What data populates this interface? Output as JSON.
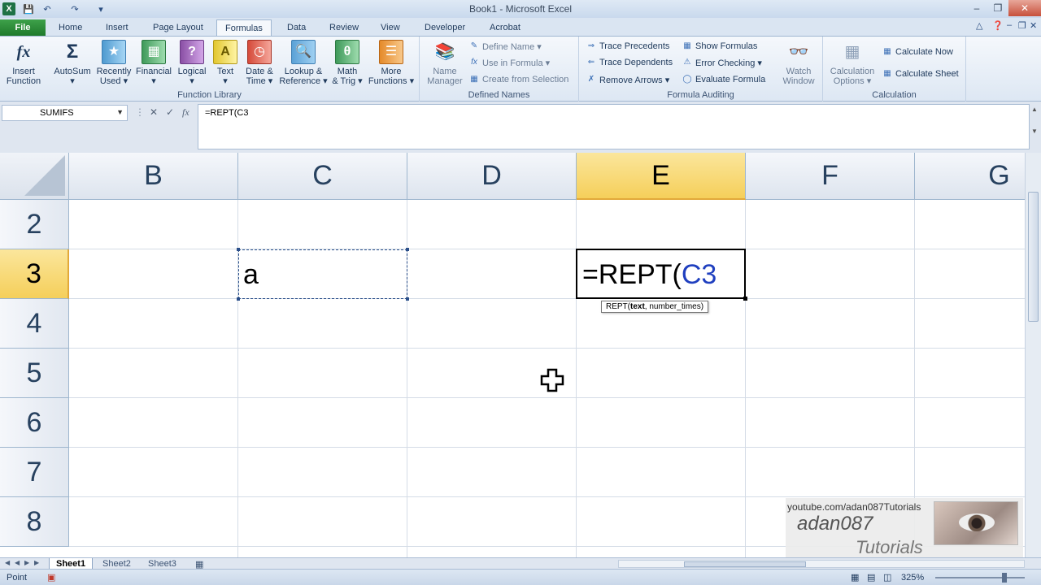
{
  "window": {
    "title": "Book1 - Microsoft Excel"
  },
  "tabs": [
    "File",
    "Home",
    "Insert",
    "Page Layout",
    "Formulas",
    "Data",
    "Review",
    "View",
    "Developer",
    "Acrobat"
  ],
  "ribbon": {
    "function_library": {
      "label": "Function Library",
      "insert_function": "Insert\nFunction",
      "buttons": [
        {
          "l1": "AutoSum",
          "l2": "▾"
        },
        {
          "l1": "Recently",
          "l2": "Used ▾"
        },
        {
          "l1": "Financial",
          "l2": "▾"
        },
        {
          "l1": "Logical",
          "l2": "▾"
        },
        {
          "l1": "Text",
          "l2": "▾"
        },
        {
          "l1": "Date &",
          "l2": "Time ▾"
        },
        {
          "l1": "Lookup &",
          "l2": "Reference ▾"
        },
        {
          "l1": "Math",
          "l2": "& Trig ▾"
        },
        {
          "l1": "More",
          "l2": "Functions ▾"
        }
      ]
    },
    "defined_names": {
      "label": "Defined Names",
      "name_manager_l1": "Name",
      "name_manager_l2": "Manager",
      "define_name": "Define Name ▾",
      "use_in_formula": "Use in Formula ▾",
      "create_from_selection": "Create from Selection"
    },
    "formula_auditing": {
      "label": "Formula Auditing",
      "trace_precedents": "Trace Precedents",
      "trace_dependents": "Trace Dependents",
      "remove_arrows": "Remove Arrows ▾",
      "show_formulas": "Show Formulas",
      "error_checking": "Error Checking ▾",
      "evaluate_formula": "Evaluate Formula",
      "watch_l1": "Watch",
      "watch_l2": "Window"
    },
    "calculation": {
      "label": "Calculation",
      "options_l1": "Calculation",
      "options_l2": "Options ▾",
      "calculate_now": "Calculate Now",
      "calculate_sheet": "Calculate Sheet"
    }
  },
  "formula_bar": {
    "name_box": "SUMIFS",
    "formula": "=REPT(C3"
  },
  "grid": {
    "columns": [
      "B",
      "C",
      "D",
      "E",
      "F",
      "G"
    ],
    "rows": [
      "2",
      "3",
      "4",
      "5",
      "6",
      "7",
      "8"
    ],
    "selected_column": "E",
    "selected_row": "3",
    "cell_c3": "a",
    "active_cell_prefix": "=REPT(",
    "active_cell_ref": "C3",
    "tooltip_fn": "REPT(",
    "tooltip_arg_bold": "text",
    "tooltip_rest": ", number_times)"
  },
  "sheets": [
    "Sheet1",
    "Sheet2",
    "Sheet3"
  ],
  "status": {
    "mode": "Point",
    "zoom": "325%"
  },
  "watermark": {
    "url": "youtube.com/adan087Tutorials",
    "name": "adan087",
    "sub": "Tutorials"
  },
  "colors": {
    "excel_green": "#1e7145",
    "selected_header": "#f5cf5a",
    "ref_blue": "#1f3fbf"
  }
}
